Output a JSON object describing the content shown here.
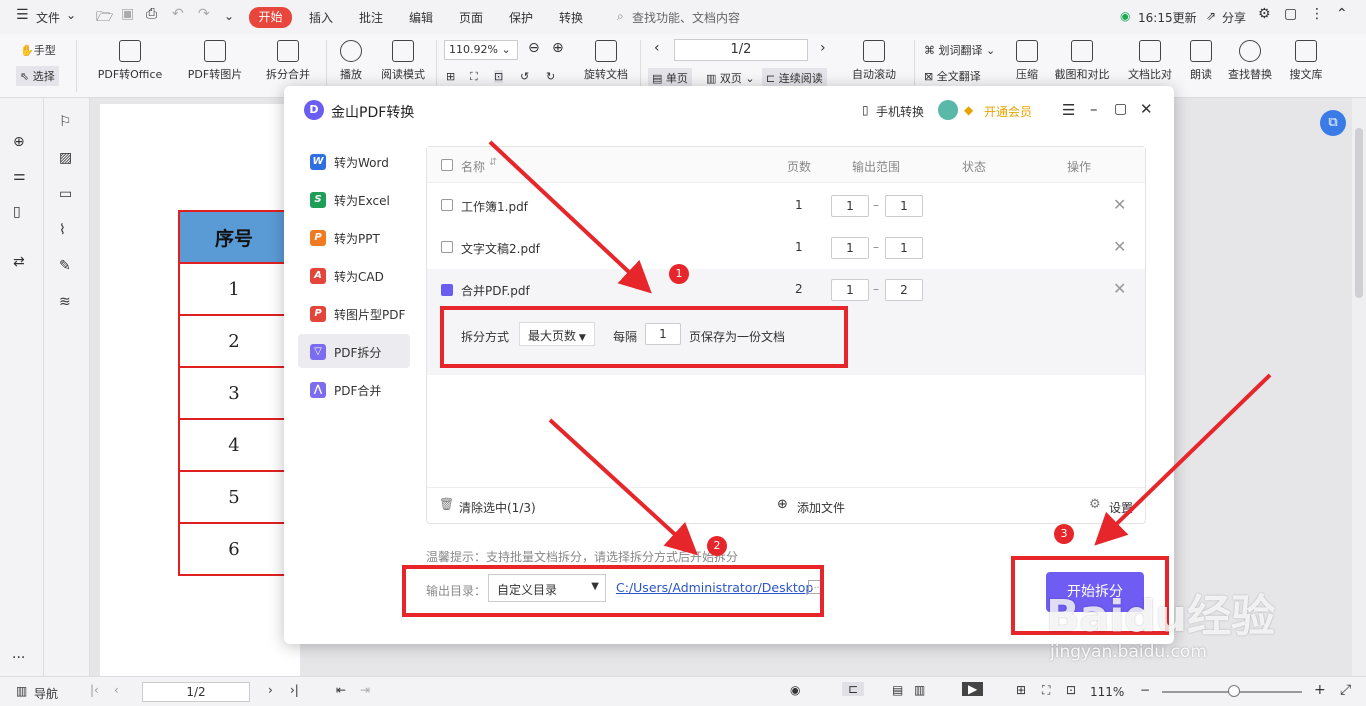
{
  "menubar": {
    "file": "文件",
    "tabs": [
      "开始",
      "插入",
      "批注",
      "编辑",
      "页面",
      "保护",
      "转换"
    ],
    "search_placeholder": "查找功能、文档内容",
    "update": "16:15更新",
    "share": "分享"
  },
  "ribbon": {
    "hand": "手型",
    "select": "选择",
    "pdf_to_office": "PDF转Office",
    "pdf_to_image": "PDF转图片",
    "split_merge": "拆分合并",
    "play": "播放",
    "reading_mode": "阅读模式",
    "zoom": "110.92%",
    "page_indicator": "1/2",
    "rotate": "旋转文档",
    "single_page": "单页",
    "double_page": "双页",
    "continuous": "连续阅读",
    "auto_scroll": "自动滚动",
    "translate_sel": "划词翻译",
    "translate_full": "全文翻译",
    "compress": "压缩",
    "screenshot_compare": "截图和对比",
    "doc_compare": "文档比对",
    "read_aloud": "朗读",
    "find_replace": "查找替换",
    "search_lib": "搜文库"
  },
  "document": {
    "header": "序号",
    "rows": [
      "1",
      "2",
      "3",
      "4",
      "5",
      "6"
    ]
  },
  "dialog": {
    "title": "金山PDF转换",
    "mobile": "手机转换",
    "vip": "开通会员",
    "nav": [
      {
        "label": "转为Word",
        "color": "#2f6fe0",
        "glyph": "W"
      },
      {
        "label": "转为Excel",
        "color": "#1e9e57",
        "glyph": "S"
      },
      {
        "label": "转为PPT",
        "color": "#ef7a22",
        "glyph": "P"
      },
      {
        "label": "转为CAD",
        "color": "#e4453b",
        "glyph": "A"
      },
      {
        "label": "转图片型PDF",
        "color": "#e4453b",
        "glyph": "P"
      },
      {
        "label": "PDF拆分",
        "color": "#7b6cf0",
        "glyph": "▽"
      },
      {
        "label": "PDF合并",
        "color": "#7b6cf0",
        "glyph": "⋀"
      }
    ],
    "columns": {
      "name": "名称",
      "pages": "页数",
      "range": "输出范围",
      "status": "状态",
      "action": "操作"
    },
    "files": [
      {
        "name": "工作簿1.pdf",
        "pages": "1",
        "from": "1",
        "to": "1",
        "checked": false
      },
      {
        "name": "文字文稿2.pdf",
        "pages": "1",
        "from": "1",
        "to": "1",
        "checked": false
      },
      {
        "name": "合并PDF.pdf",
        "pages": "2",
        "from": "1",
        "to": "2",
        "checked": true
      }
    ],
    "split": {
      "label": "拆分方式",
      "mode": "最大页数",
      "every": "每隔",
      "count": "1",
      "suffix": "页保存为一份文档"
    },
    "clear": "清除选中(1/3)",
    "add_file": "添加文件",
    "settings": "设置",
    "hint": "温馨提示：支持批量文档拆分，请选择拆分方式后开始拆分",
    "output_label": "输出目录：",
    "output_mode": "自定义目录",
    "output_path": "C:/Users/Administrator/Desktop",
    "start": "开始拆分"
  },
  "annotations": [
    "1",
    "2",
    "3"
  ],
  "statusbar": {
    "nav": "导航",
    "page": "1/2",
    "zoom": "111%"
  },
  "watermark": {
    "brand": "Baidu经验",
    "url": "jingyan.baidu.com"
  }
}
